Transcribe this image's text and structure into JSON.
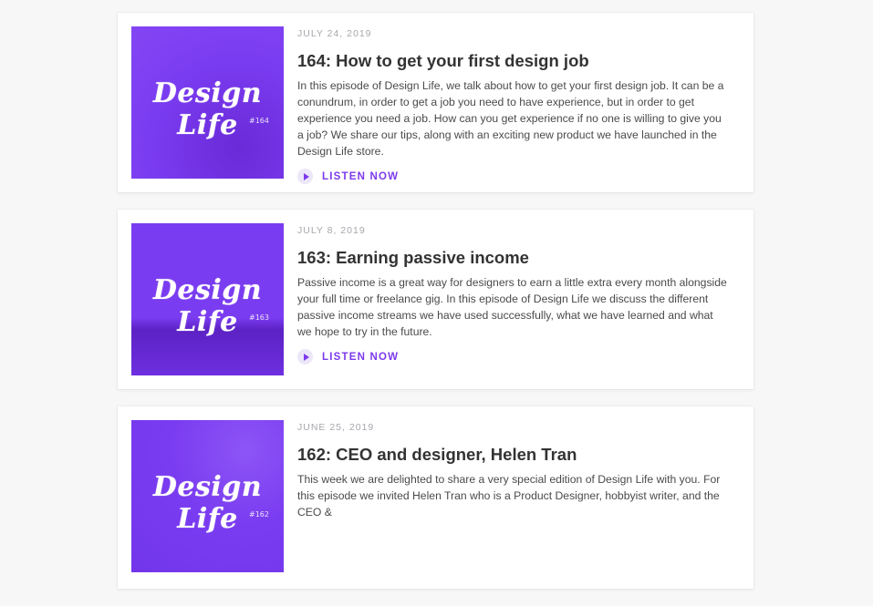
{
  "episodes": [
    {
      "date": "JULY 24, 2019",
      "title": "164: How to get your first design job",
      "description": "In this episode of Design Life, we talk about how to get your first design job. It can be a conundrum, in order to get a job you need to have experience, but in order to get experience you need a job. How can you get experience if no one is willing to give you a job? We share our tips, along with an exciting new product we have launched in the Design Life store.",
      "cover_logo": "Design Life",
      "cover_number": "#164",
      "listen_label": "LISTEN NOW"
    },
    {
      "date": "JULY 8, 2019",
      "title": "163: Earning passive income",
      "description": "Passive income is a great way for designers to earn a little extra every month alongside your full time or freelance gig. In this episode of Design Life we discuss the different passive income streams we have used successfully, what we have learned and what we hope to try in the future.",
      "cover_logo": "Design Life",
      "cover_number": "#163",
      "listen_label": "LISTEN NOW"
    },
    {
      "date": "JUNE 25, 2019",
      "title": "162: CEO and designer, Helen Tran",
      "description": "This week we are delighted to share a very special edition of Design Life with you. For this episode we invited Helen Tran who is a Product Designer, hobbyist writer, and the CEO &",
      "cover_logo": "Design Life",
      "cover_number": "#162"
    }
  ],
  "colors": {
    "accent": "#7c3aed",
    "cover": "#7a3cf0",
    "background": "#f7f7f8"
  },
  "icons": {
    "play": "play-icon"
  }
}
